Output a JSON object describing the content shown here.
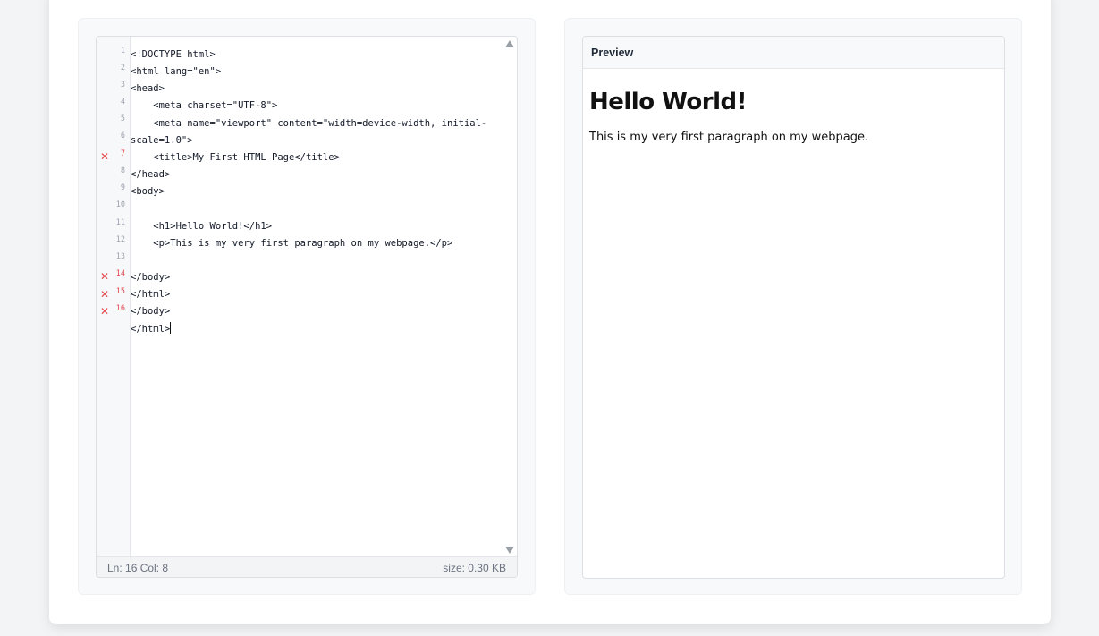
{
  "editor": {
    "gutter": [
      {
        "num": "1",
        "error": false
      },
      {
        "num": "2",
        "error": false
      },
      {
        "num": "3",
        "error": false
      },
      {
        "num": "4",
        "error": false
      },
      {
        "num": "5",
        "error": false
      },
      {
        "num": "6",
        "error": false
      },
      {
        "num": "7",
        "error": true
      },
      {
        "num": "8",
        "error": false
      },
      {
        "num": "9",
        "error": false
      },
      {
        "num": "10",
        "error": false
      },
      {
        "num": "11",
        "error": false
      },
      {
        "num": "12",
        "error": false
      },
      {
        "num": "13",
        "error": false
      },
      {
        "num": "14",
        "error": true
      },
      {
        "num": "15",
        "error": true
      },
      {
        "num": "16",
        "error": true
      }
    ],
    "lines": [
      "<!DOCTYPE html>",
      "<html lang=\"en\">",
      "<head>",
      "    <meta charset=\"UTF-8\">",
      "    <meta name=\"viewport\" content=\"width=device-width, initial-",
      "scale=1.0\">",
      "    <title>My First HTML Page</title>",
      "</head>",
      "<body>",
      "",
      "    <h1>Hello World!</h1>",
      "    <p>This is my very first paragraph on my webpage.</p>",
      "",
      "</body>",
      "</html>",
      "</body>",
      "</html>"
    ],
    "error_marker": "✕",
    "status": {
      "position": "Ln: 16 Col: 8",
      "size": "size: 0.30 KB"
    }
  },
  "preview": {
    "header": "Preview",
    "heading": "Hello World!",
    "paragraph": "This is my very first paragraph on my webpage."
  },
  "colors": {
    "error": "#e5484d",
    "panel_bg": "#f8f9fb",
    "border": "#dcdfe4"
  }
}
